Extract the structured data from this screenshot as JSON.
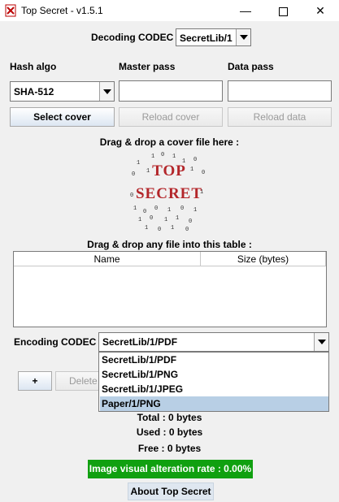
{
  "window": {
    "title": "Top Secret - v1.5.1",
    "minimize_symbol": "—",
    "close_symbol": "✕"
  },
  "decoding": {
    "label": "Decoding CODEC :",
    "value": "SecretLib/1"
  },
  "columns": {
    "hash_label": "Hash algo",
    "master_label": "Master pass",
    "data_label": "Data pass"
  },
  "hash": {
    "value": "SHA-512"
  },
  "buttons": {
    "select_cover": "Select cover",
    "reload_cover": "Reload cover",
    "reload_data": "Reload data",
    "add": "+",
    "delete": "Delete",
    "about": "About Top Secret"
  },
  "cover": {
    "drop_label": "Drag & drop a cover file here :",
    "logo_line1": "TOP",
    "logo_line2": "SECRET",
    "logo_digits": "1 0 1 1 0 1 0 1 0 1 1 0 0 1 0 1"
  },
  "files": {
    "drop_label": "Drag & drop any file into this table :",
    "headers": [
      "Name",
      "Size (bytes)"
    ],
    "rows": []
  },
  "encoding": {
    "label": "Encoding CODEC :",
    "value": "SecretLib/1/PDF",
    "options": [
      "SecretLib/1/PDF",
      "SecretLib/1/PNG",
      "SecretLib/1/JPEG",
      "Paper/1/PNG"
    ],
    "highlighted": "Paper/1/PNG"
  },
  "stats": {
    "total": "Total : 0 bytes",
    "used": "Used : 0 bytes",
    "free": "Free : 0 bytes"
  },
  "alteration": {
    "text": "Image visual alteration rate : 0.00%",
    "color": "#10a010"
  },
  "icons": {
    "app": "top-secret-app-icon",
    "dropdown": "chevron-down-icon"
  }
}
